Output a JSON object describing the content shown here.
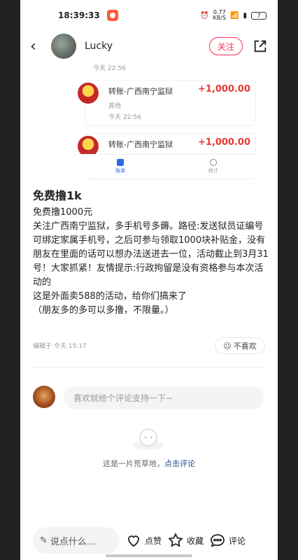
{
  "status_bar": {
    "time": "18:39:33",
    "network_speed": "0.77\nKB/S",
    "battery": "7"
  },
  "header": {
    "back_icon": "chevron-left-icon",
    "username": "Lucky",
    "follow_label": "关注",
    "share_icon": "share-icon"
  },
  "embedded_screenshot": {
    "partial_time": "今天 22:56",
    "transactions": [
      {
        "title": "转账-广西南宁监狱",
        "subtitle": "其他",
        "time": "今天 22:56",
        "amount": "+1,000.00"
      },
      {
        "title": "转账-广西南宁监狱",
        "subtitle": "",
        "time": "",
        "amount": "+1,000.00"
      }
    ],
    "tabs": [
      {
        "label": "账单",
        "active": true
      },
      {
        "label": "统计",
        "active": false
      }
    ]
  },
  "post": {
    "title": "免费撸1k",
    "lines": [
      "免费撸1000元",
      "关注广西南宁监狱，多手机号多薅。路径:发送狱员证编号可绑定家属手机号，之后可参与领取1000块补贴金，没有朋友在里面的话可以想办法送进去一位，活动截止到3月31号！大家抓紧！友情提示:行政拘留是没有资格参与本次活动的",
      "这是外面卖588的活动，给你们搞来了",
      "（朋友多的多可以多撸，不限量。）"
    ],
    "edited": "编辑于 今天 15:17",
    "dislike_label": "不喜欢"
  },
  "comments": {
    "input_placeholder": "喜欢就给个评论支持一下~",
    "empty_text": "这是一片荒草地，",
    "empty_link": "点击评论"
  },
  "bottom_bar": {
    "input_placeholder": "说点什么...",
    "like_label": "点赞",
    "collect_label": "收藏",
    "comment_label": "评论"
  },
  "colors": {
    "accent": "#ff2d55",
    "amount": "#e53935",
    "link": "#1d4f91"
  }
}
